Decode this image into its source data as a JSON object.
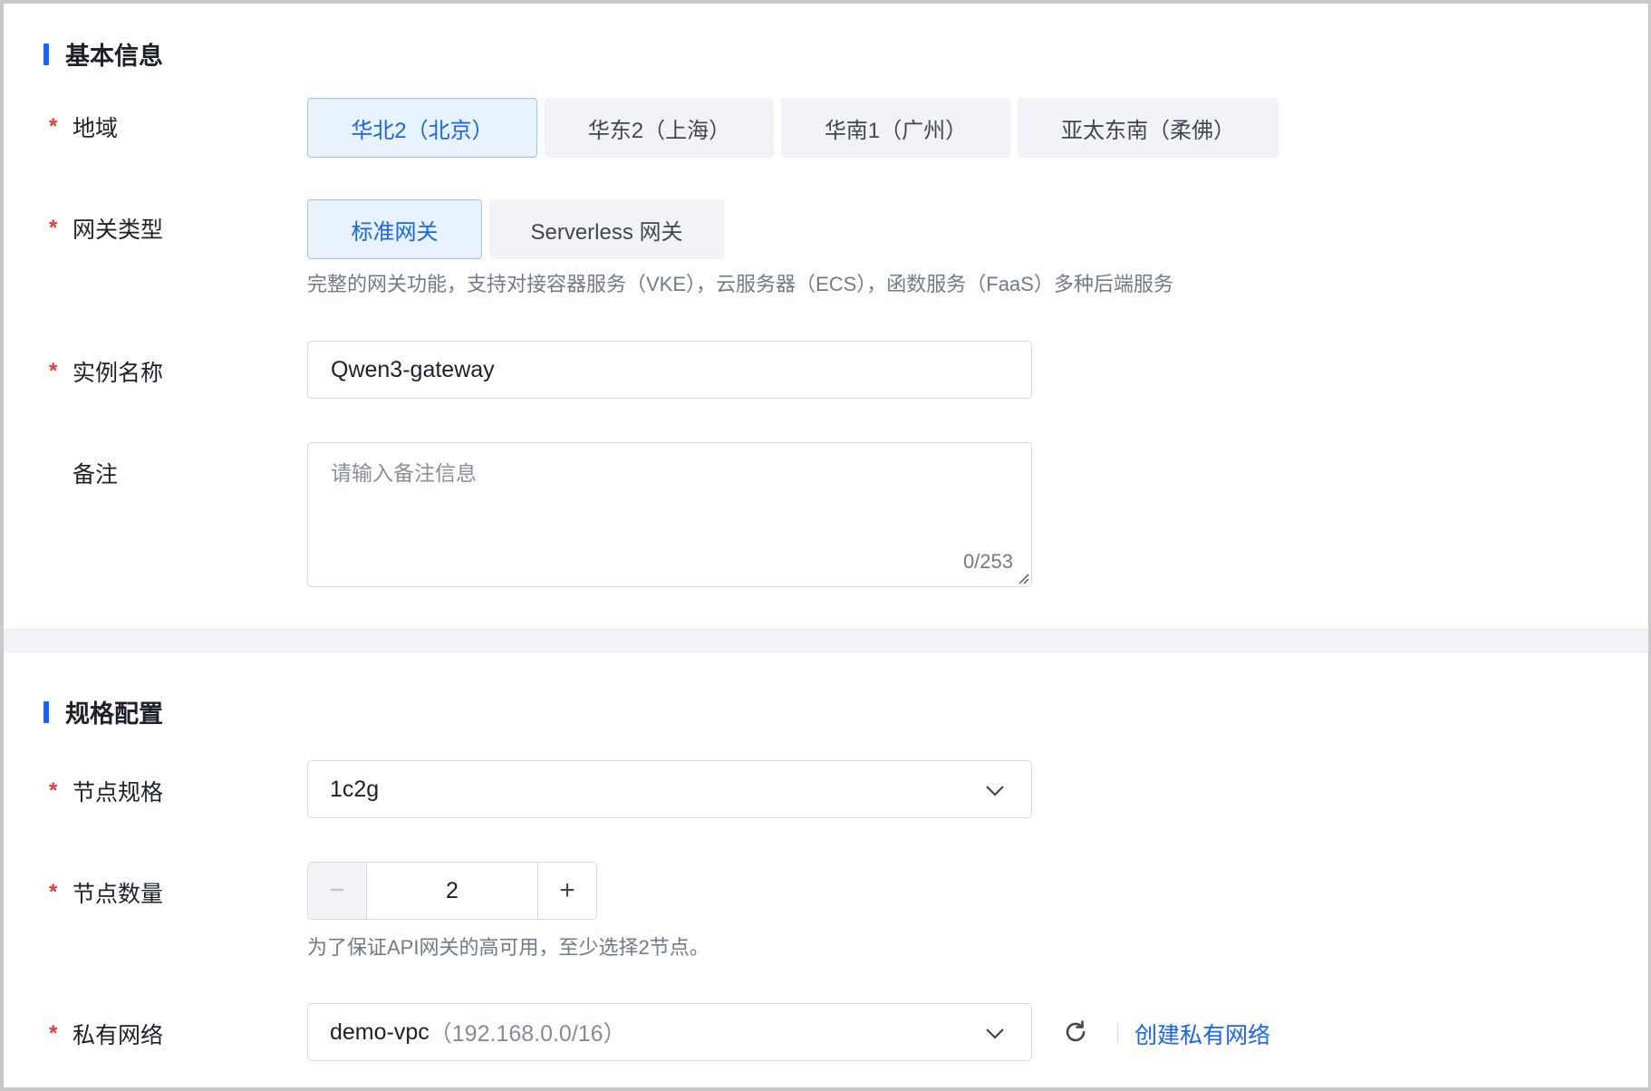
{
  "basic": {
    "title": "基本信息",
    "region": {
      "label": "地域",
      "options": [
        "华北2（北京）",
        "华东2（上海）",
        "华南1（广州）",
        "亚太东南（柔佛）"
      ],
      "selected": 0
    },
    "gateway_type": {
      "label": "网关类型",
      "options": [
        "标准网关",
        "Serverless 网关"
      ],
      "selected": 0,
      "hint": "完整的网关功能，支持对接容器服务（VKE），云服务器（ECS），函数服务（FaaS）多种后端服务"
    },
    "instance_name": {
      "label": "实例名称",
      "value": "Qwen3-gateway"
    },
    "remark": {
      "label": "备注",
      "placeholder": "请输入备注信息",
      "counter": "0/253"
    }
  },
  "spec": {
    "title": "规格配置",
    "node_spec": {
      "label": "节点规格",
      "value": "1c2g"
    },
    "node_count": {
      "label": "节点数量",
      "value": "2",
      "minus": "−",
      "plus": "+",
      "hint": "为了保证API网关的高可用，至少选择2节点。"
    },
    "vpc": {
      "label": "私有网络",
      "value": "demo-vpc",
      "cidr": "（192.168.0.0/16）",
      "create_link": "创建私有网络"
    }
  },
  "required_mark": "*",
  "colors": {
    "accent": "#1664ff",
    "required": "#e53935",
    "active_bg": "#e8f3ff"
  }
}
